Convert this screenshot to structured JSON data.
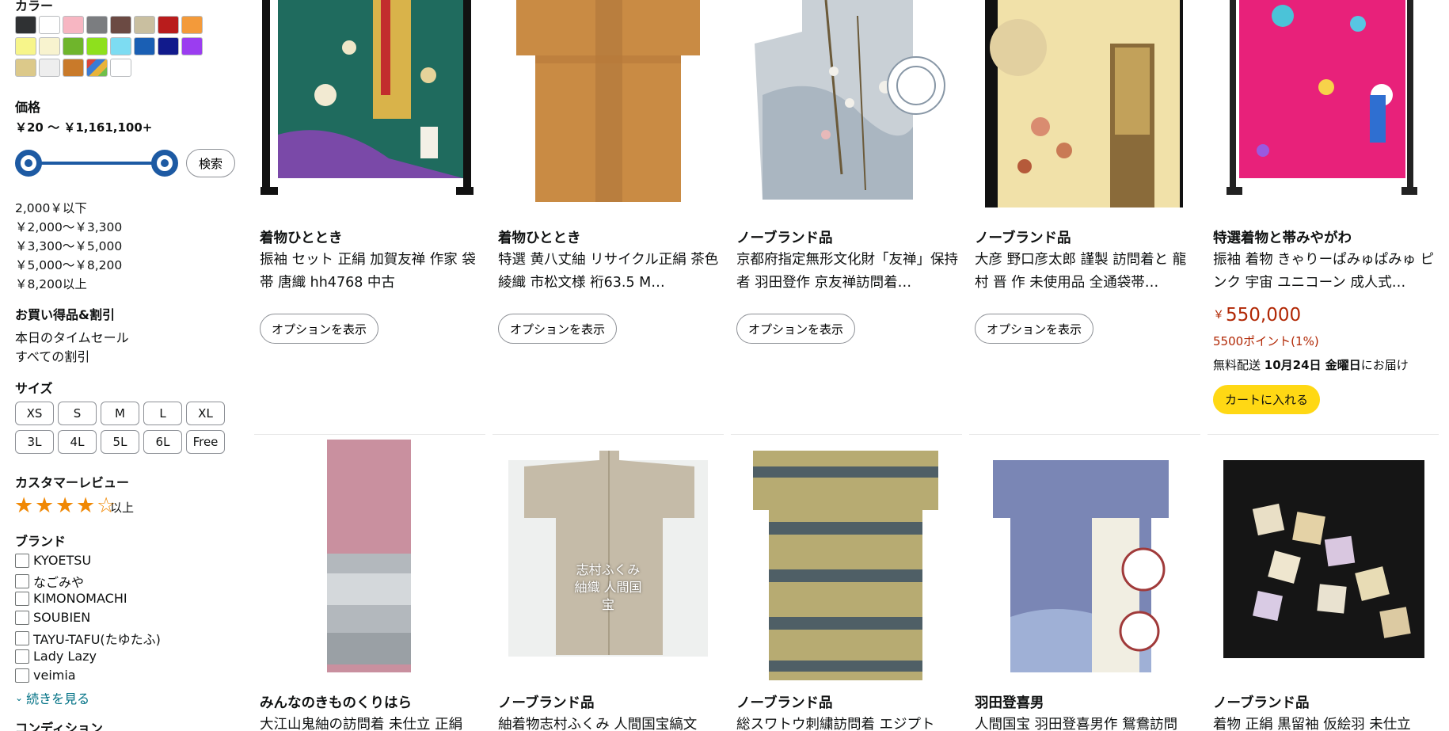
{
  "sidebar": {
    "color_heading": "カラー",
    "colors": [
      "#2f3133",
      "#ffffff",
      "#f7b6c2",
      "#7b7d80",
      "#6b4a43",
      "#c9bfa0",
      "#b91c1c",
      "#f39a3a",
      "#f7f58a",
      "#f8f3cf",
      "#6fb52c",
      "#8ee01d",
      "#7ddcf2",
      "#1a5fb4",
      "#111a8c",
      "#9b3df0",
      "#dcc98a",
      "#eeeeee",
      "#c97a2a",
      "multi",
      "#ffffff"
    ],
    "price_heading": "価格",
    "price_range": "￥20 〜 ￥1,161,100+",
    "price_go": "検索",
    "price_options": [
      "2,000￥以下",
      "￥2,000〜￥3,300",
      "￥3,300〜￥5,000",
      "￥5,000〜￥8,200",
      "￥8,200以上"
    ],
    "deals_heading": "お買い得品&割引",
    "deals": [
      "本日のタイムセール",
      "すべての割引"
    ],
    "size_heading": "サイズ",
    "sizes": [
      "XS",
      "S",
      "M",
      "L",
      "XL",
      "3L",
      "4L",
      "5L",
      "6L",
      "Free"
    ],
    "review_heading": "カスタマーレビュー",
    "review_rating": 4,
    "review_suffix": "以上",
    "brand_heading": "ブランド",
    "brands": [
      "KYOETSU",
      "なごみや",
      "KIMONOMACHI",
      "SOUBIEN",
      "TAYU-TAFU(たゆたふ)",
      "Lady Lazy",
      "veimia"
    ],
    "see_more": "続きを見る",
    "condition_heading": "コンディション"
  },
  "products": [
    {
      "brand": "着物ひととき",
      "title": "振袖 セット 正絹 加賀友禅 作家 袋帯 唐織 hh4768 中古",
      "button": "オプションを表示"
    },
    {
      "brand": "着物ひととき",
      "title": "特選 黄八丈紬 リサイクル正絹 茶色 綾織 市松文様 裄63.5 M…",
      "button": "オプションを表示"
    },
    {
      "brand": "ノーブランド品",
      "title": "京都府指定無形文化財「友禅」保持者 羽田登作 京友禅訪問着…",
      "button": "オプションを表示"
    },
    {
      "brand": "ノーブランド品",
      "title": "大彦 野口彦太郎 謹製 訪問着と 龍村 晋 作 未使用品 全通袋帯…",
      "button": "オプションを表示"
    },
    {
      "brand": "特選着物と帯みやがわ",
      "title": "振袖 着物 きゃりーぱみゅぱみゅ ピンク 宇宙 ユニコーン 成人式…",
      "price": "550,000",
      "price_symbol": "￥",
      "points": "5500ポイント(1%)",
      "delivery_prefix": "無料配送 ",
      "delivery_date": "10月24日 金曜日",
      "delivery_suffix": "にお届け",
      "cart": "カートに入れる"
    },
    {
      "brand": "みんなのきものくりはら",
      "title": "大江山鬼紬の訪問着 未仕立 正絹"
    },
    {
      "brand": "ノーブランド品",
      "title": "紬着物志村ふくみ 人間国宝縞文",
      "overlay": "志村ふくみ\n紬織 人間国宝"
    },
    {
      "brand": "ノーブランド品",
      "title": "総スワトウ刺繍訪問着 エジプト"
    },
    {
      "brand": "羽田登喜男",
      "title": "人間国宝 羽田登喜男作 鴛鴦訪問"
    },
    {
      "brand": "ノーブランド品",
      "title": "着物 正絹 黒留袖 仮絵羽 未仕立"
    }
  ]
}
